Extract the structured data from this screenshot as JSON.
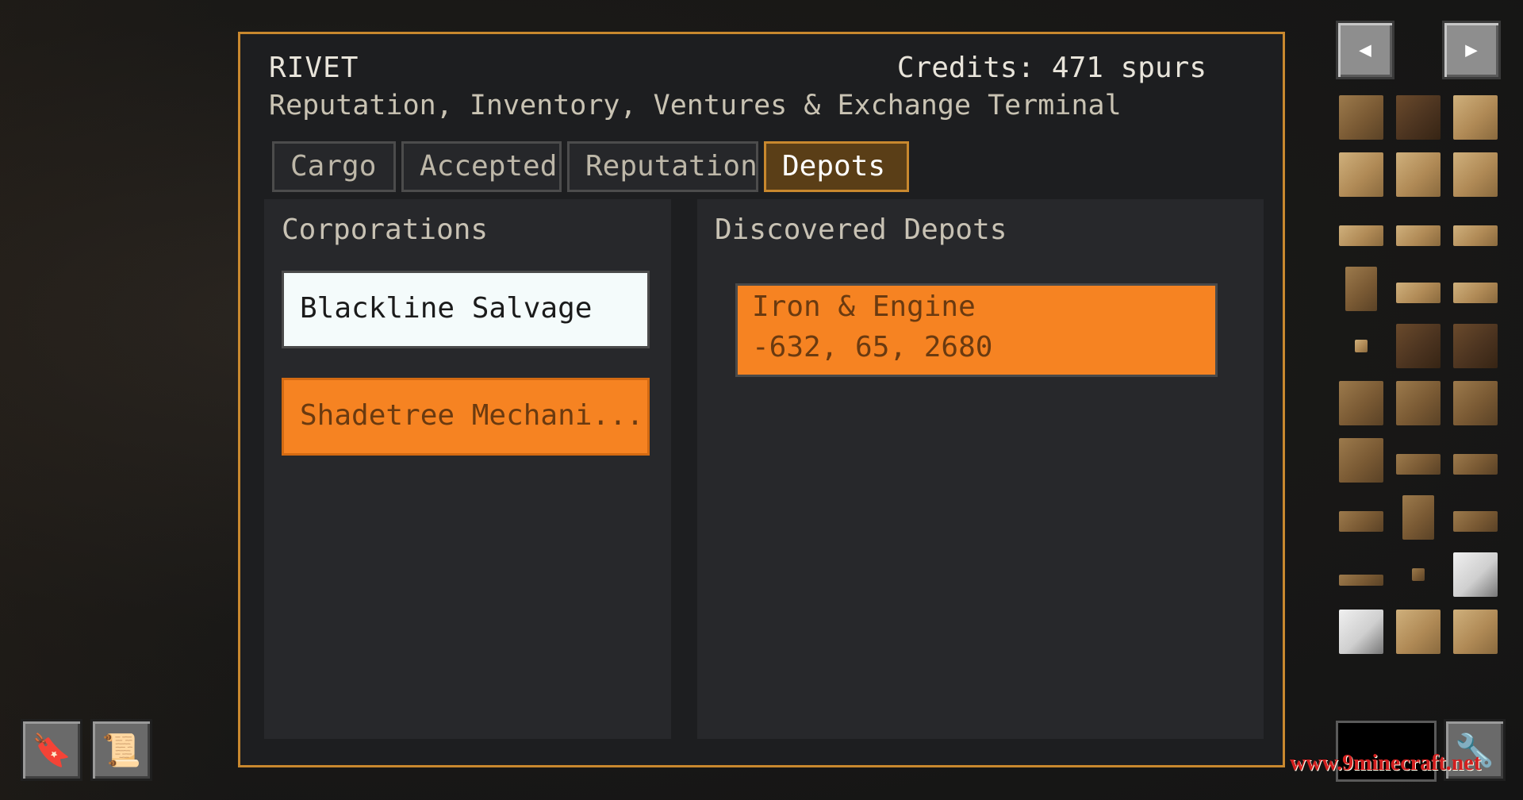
{
  "header": {
    "title": "RIVET",
    "credits": "Credits: 471 spurs",
    "subtitle": "Reputation, Inventory, Ventures & Exchange Terminal"
  },
  "tabs": [
    {
      "label": "Cargo",
      "active": false
    },
    {
      "label": "Accepted",
      "active": false
    },
    {
      "label": "Reputation",
      "active": false
    },
    {
      "label": "Depots",
      "active": true
    }
  ],
  "corporations": {
    "title": "Corporations",
    "items": [
      "Blackline Salvage",
      "Shadetree Mechani..."
    ]
  },
  "depots": {
    "title": "Discovered Depots",
    "items": [
      {
        "name": "Iron & Engine",
        "coords": "-632, 65, 2680"
      }
    ]
  },
  "inventory_nav": {
    "prev_icon": "arrow-left-icon",
    "next_icon": "arrow-right-icon"
  },
  "bottom_icons": [
    "bookmark-icon",
    "scroll-icon",
    "wrench-icon"
  ],
  "watermark": "www.9minecraft.net",
  "colors": {
    "accent": "#c8882e",
    "orange": "#f68322",
    "panel": "#1d1e20"
  }
}
